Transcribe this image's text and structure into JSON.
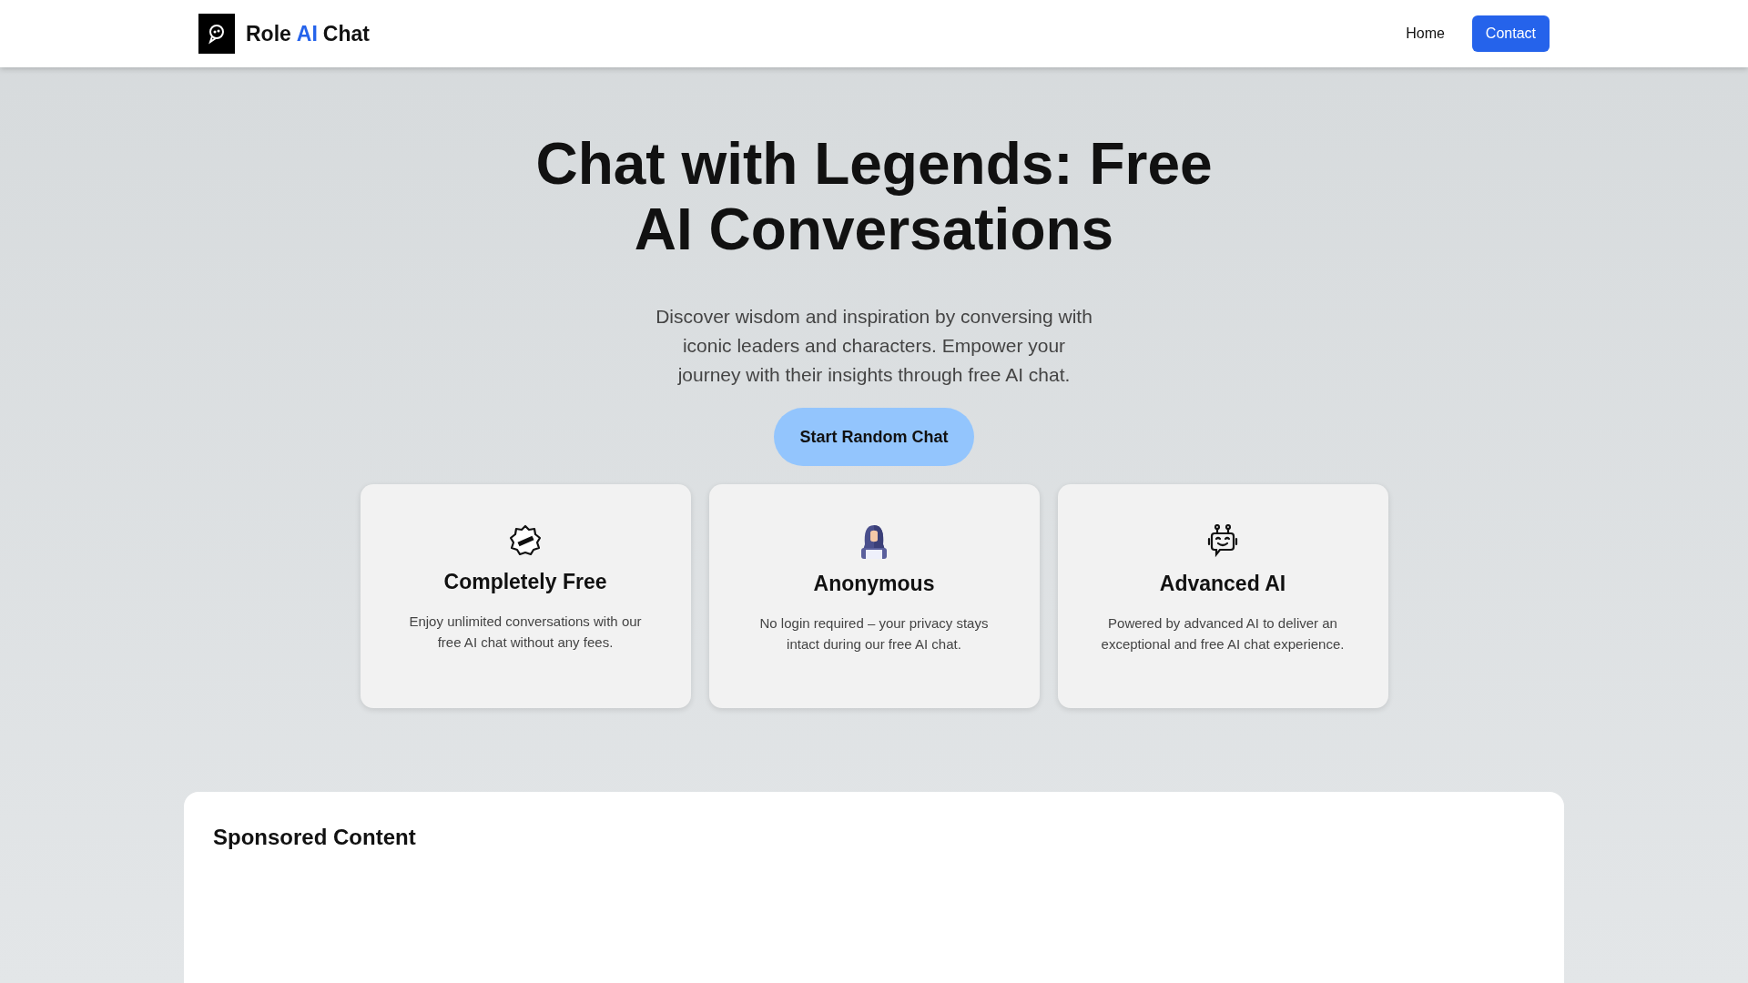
{
  "header": {
    "brand": [
      {
        "text": "Role",
        "accent": false
      },
      {
        "text": "AI",
        "accent": true
      },
      {
        "text": "Chat",
        "accent": false
      }
    ],
    "nav": [
      {
        "label": "Home",
        "kind": "link"
      },
      {
        "label": "Contact",
        "kind": "button"
      }
    ]
  },
  "hero": {
    "title": "Chat with Legends: Free AI Conversations",
    "subtitle": "Discover wisdom and inspiration by conversing with iconic leaders and characters. Empower your journey with their insights through free AI chat.",
    "button": "Start Random Chat"
  },
  "features": [
    {
      "kind": "free",
      "title": "Completely Free",
      "text": "Enjoy unlimited conversations with our free AI chat without any fees."
    },
    {
      "kind": "anonymous",
      "title": "Anonymous",
      "text": "No login required – your privacy stays intact during our free AI chat."
    },
    {
      "kind": "robot",
      "title": "Advanced AI",
      "text": "Powered by advanced AI to deliver an exceptional and free AI chat experience."
    }
  ],
  "sponsored": {
    "title": "Sponsored Content"
  }
}
